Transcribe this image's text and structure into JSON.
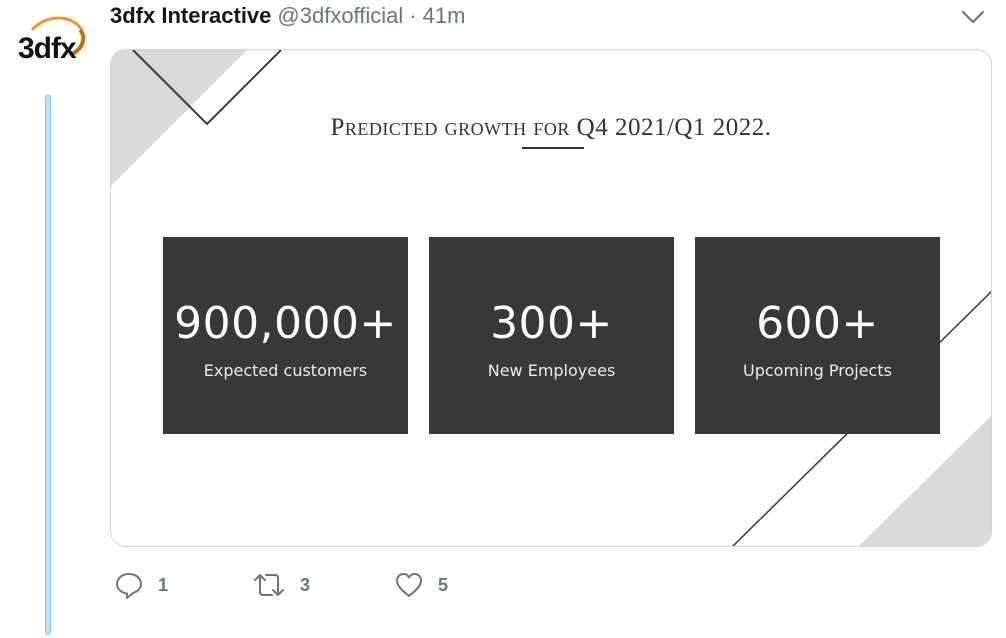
{
  "author": {
    "name": "3dfx Interactive",
    "handle": "@3dfxofficial",
    "separator": "·",
    "time": "41m",
    "logo_text": "3dfx"
  },
  "media": {
    "headline": "Predicted growth for Q4 2021/Q1 2022.",
    "stats": [
      {
        "value": "900,000+",
        "label": "Expected customers"
      },
      {
        "value": "300+",
        "label": "New Employees"
      },
      {
        "value": "600+",
        "label": "Upcoming Projects"
      }
    ]
  },
  "actions": {
    "reply_count": "1",
    "retweet_count": "3",
    "like_count": "5"
  },
  "icons": {
    "menu": "chevron-down-icon",
    "reply": "speech-bubble-icon",
    "retweet": "retweet-arrows-icon",
    "like": "heart-icon"
  },
  "colors": {
    "text_primary": "#14171a",
    "text_secondary": "#657786",
    "thread_line": "#79c3ea",
    "stat_box": "#383838"
  }
}
